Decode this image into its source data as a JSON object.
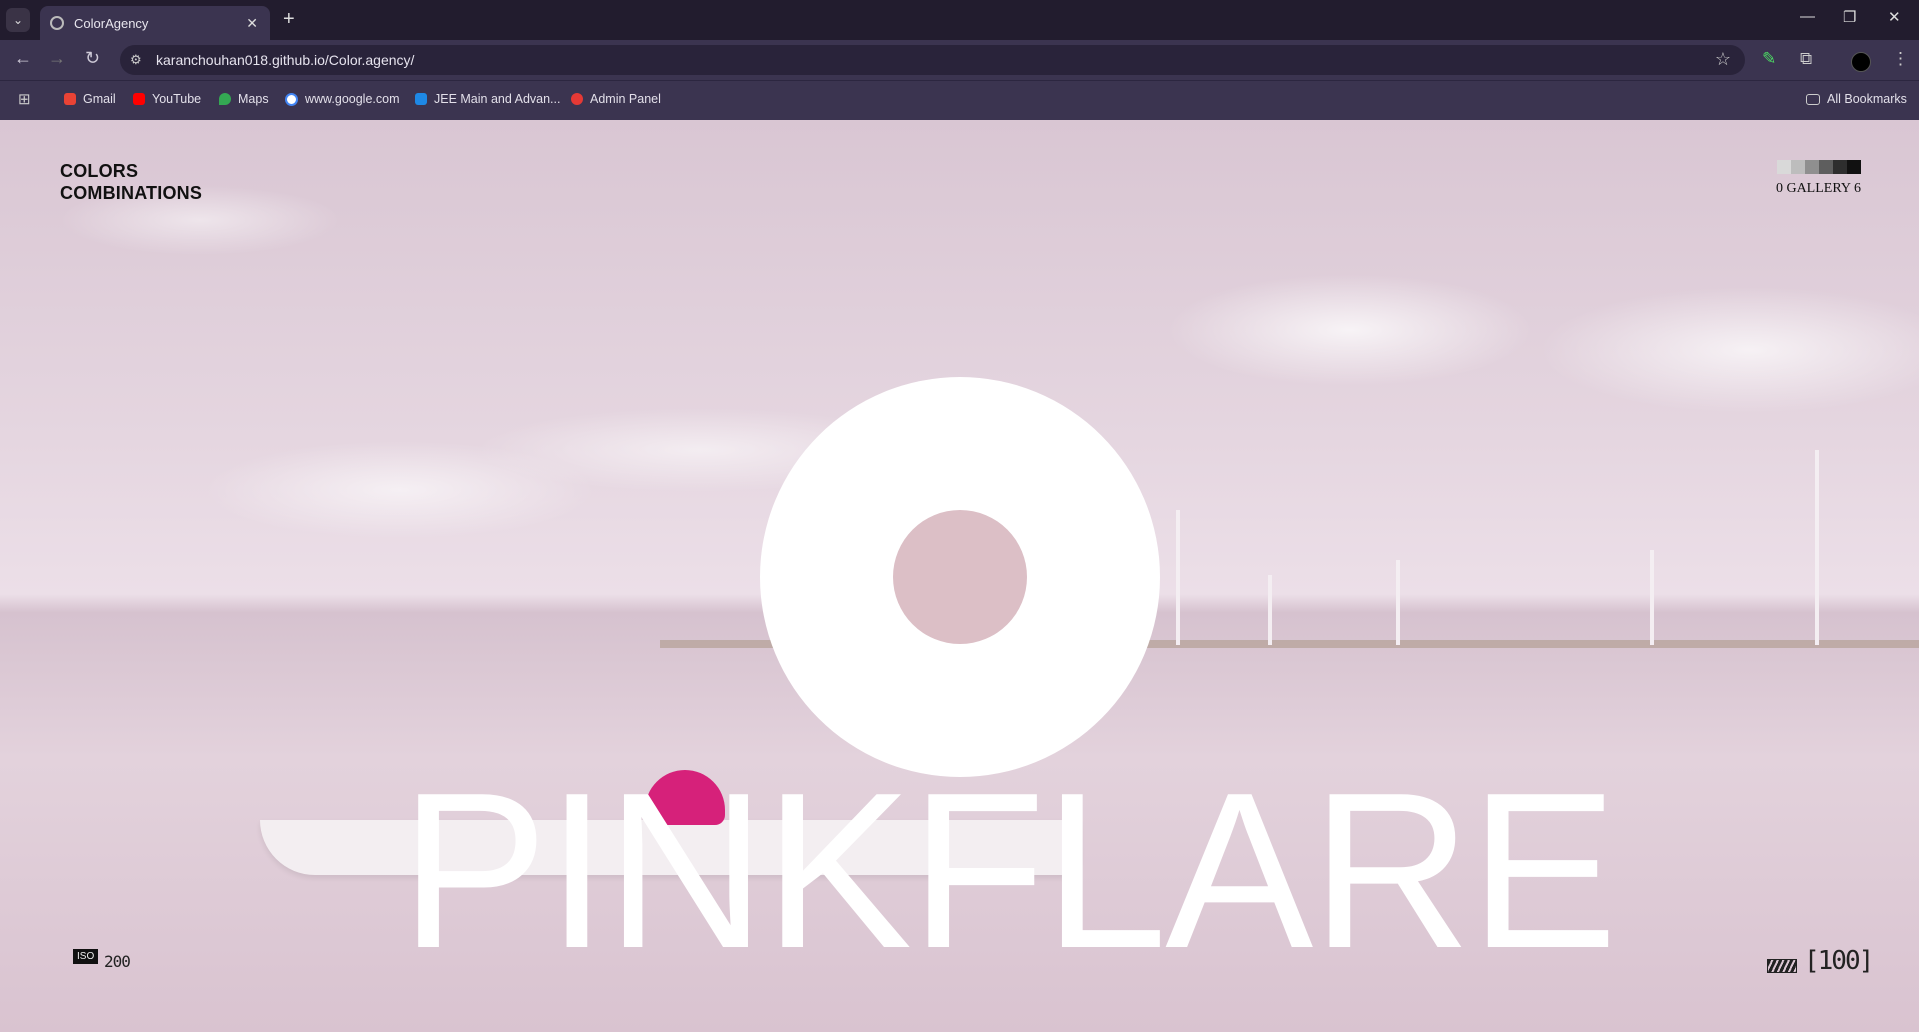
{
  "browser": {
    "tab_title": "ColorAgency",
    "url": "karanchouhan018.github.io/Color.agency/",
    "bookmarks": [
      "Gmail",
      "YouTube",
      "Maps",
      "www.google.com",
      "JEE Main and Advan...",
      "Admin Panel"
    ],
    "all_bookmarks": "All Bookmarks"
  },
  "site": {
    "logo_line1": "COLORS",
    "logo_line2": "COMBINATIONS",
    "gallery_label": "0 GALLERY 6",
    "swatch_colors": [
      "#d9d9d9",
      "#bdbdbd",
      "#8f8f8f",
      "#5e5e5e",
      "#2e2e2e",
      "#111111"
    ],
    "headline": "PINKFLARE",
    "accent_color": "#dcbfc6",
    "iso_label": "ISO",
    "iso_value": "200",
    "shot_count": "[100]"
  }
}
